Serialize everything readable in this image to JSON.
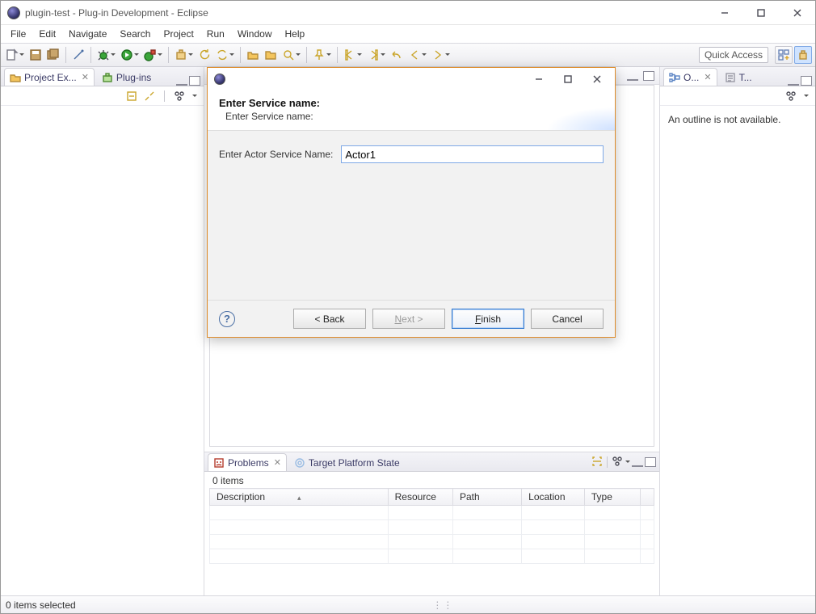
{
  "window": {
    "title": "plugin-test - Plug-in Development - Eclipse"
  },
  "menu": [
    "File",
    "Edit",
    "Navigate",
    "Search",
    "Project",
    "Run",
    "Window",
    "Help"
  ],
  "toolbar": {
    "quick_access": "Quick Access"
  },
  "left_tabs": {
    "project_explorer": "Project Ex...",
    "plugins": "Plug-ins"
  },
  "right_tabs": {
    "outline": "O...",
    "task": "T...",
    "outline_empty": "An outline is not available."
  },
  "bottom_tabs": {
    "problems": "Problems",
    "target": "Target Platform State",
    "items_count": "0 items",
    "cols": {
      "description": "Description",
      "resource": "Resource",
      "path": "Path",
      "location": "Location",
      "type": "Type"
    }
  },
  "status": {
    "text": "0 items selected"
  },
  "dialog": {
    "banner_title": "Enter Service name:",
    "banner_sub": "Enter Service name:",
    "field_label": "Enter Actor Service Name:",
    "field_value": "Actor1",
    "back": "< Back",
    "next": "Next >",
    "finish": "Finish",
    "cancel": "Cancel"
  }
}
